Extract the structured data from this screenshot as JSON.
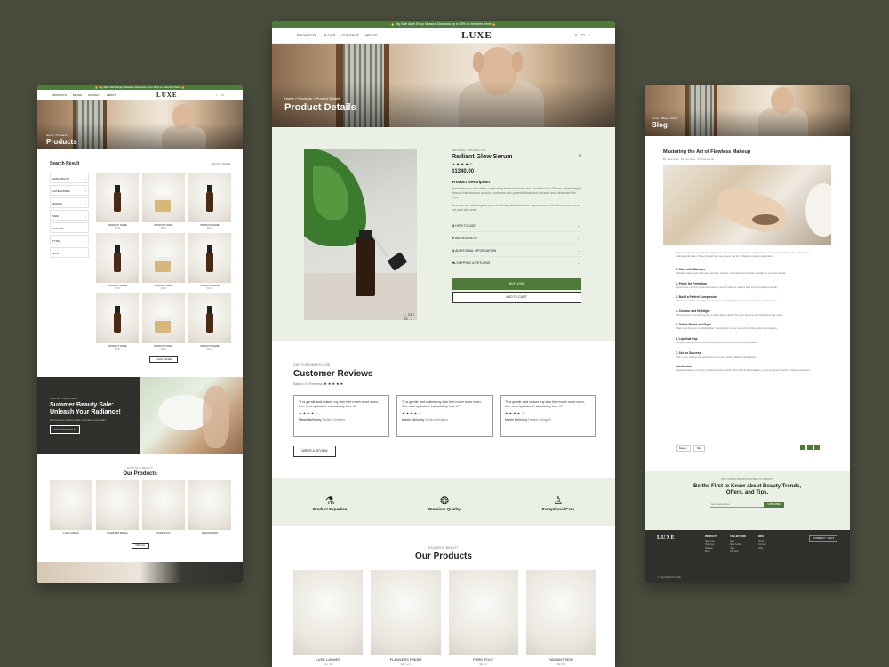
{
  "center": {
    "promo": "🔥 Big Sale Alert! Enjoy Massive Discounts up to 50% on Selected Items 🔥",
    "nav": [
      "PRODUCTS",
      "BLOGS",
      "CONTACT",
      "ABOUT"
    ],
    "logo": "LUXE",
    "breadcrumb": "Home > Products > Product Details",
    "hero_title": "Product Details",
    "pager": "01 / 03",
    "category": "ORGANIC PRODUCTS",
    "product_name": "Radiant Glow Serum",
    "price": "$1340.00",
    "desc_heading": "Product Description",
    "desc_p1": "Illuminate your skin with a captivating luminosity that lasts. Radiant Glow Serum, a lightweight formula that absorbs quickly, nourishes with powerful botanical extracts and minimizes fine lines.",
    "desc_p2": "Embrace the radiant glow as it effortlessly diminishes the appearance of fine lines and evens out your skin tone.",
    "accordion": [
      "HOW TO USE",
      "INGREDIENTS",
      "ADDITIONAL INFORMATION",
      "SHIPPING & RETURNS"
    ],
    "buy_now": "BUY NOW",
    "add_to_cart": "ADD TO CART",
    "reviews_eyebrow": "OUR CUSTOMERS LOVE",
    "reviews_title": "Customer Reviews",
    "based_on": "Based on Reviews",
    "review_text": "\"It is gentle and makes my skin feel much more even, firm, and hydrated. I absolutely love it!\"",
    "review_author": "Marvin McKinney",
    "review_role": "Fashion Designer",
    "write_review": "WRITE A REVIEW",
    "features": [
      "Product Expertise",
      "Premium Quality",
      "Exceptional Care"
    ],
    "products_eyebrow": "EXQUISITE BEAUTY",
    "products_title": "Our Products",
    "products": [
      {
        "name": "LUXE LASHES",
        "price": "$17.54"
      },
      {
        "name": "FLAWLESS FINISH",
        "price": "$41.22"
      },
      {
        "name": "PURE POUT",
        "price": "$8.70"
      },
      {
        "name": "RADIANT SKIN",
        "price": "$9.90"
      }
    ]
  },
  "left": {
    "promo": "🔥 Big Sale Alert! Enjoy Massive Discounts up to 50% on Selected Items 🔥",
    "nav": [
      "PRODUCTS",
      "BLOGS",
      "CONTACT",
      "ABOUT"
    ],
    "logo": "LUXE",
    "hero_crumb": "Home > Products",
    "hero_title": "Products",
    "search_result": "Search Result",
    "sort": "Sort by: Default",
    "filters": [
      "AVAILABILITY",
      "CATEGORIES",
      "RANGE",
      "SIZE",
      "COLORS",
      "TYPE",
      "SKIN"
    ],
    "grid_label": "PRODUCT NAME",
    "grid_price": "$0.00",
    "load_more": "LOAD MORE",
    "sale_eyebrow": "LIMITED TIME OFFER",
    "sale_title": "Summer Beauty Sale: Unleash Your Radiance!",
    "sale_sub": "Discover the hottest deals on beauty essentials",
    "shop_sale": "SHOP THE SALE",
    "products_eyebrow": "EXQUISITE BEAUTY",
    "products_title": "Our Products",
    "view_all": "VIEW ALL",
    "products": [
      "LUXE LASHES",
      "FLAWLESS FINISH",
      "PURE POUT",
      "RADIANT SKIN"
    ]
  },
  "right": {
    "crumb": "Home > Blog > Article",
    "hero_title": "Blog",
    "article_title": "Mastering the Art of Flawless Makeup",
    "meta": "By Jane Doe · 10 min read · 24 Comments",
    "intro": "Flawless makeup is an art that empowers us to enhance our features and express ourselves. Whether you're a novice or a makeup enthusiast, these tips will help you master the art of flawless makeup application.",
    "steps": [
      {
        "h": "1. Start with Skincare",
        "p": "A flawless base begins with good skincare. Cleanse, moisturize, and exfoliate regularly for a smooth canvas."
      },
      {
        "h": "2. Prime for Perfection",
        "p": "Primer helps minimize pores and creates a smooth base so makeup lasts longer throughout the day."
      },
      {
        "h": "3. Build a Perfect Complexion",
        "p": "Select a foundation matching your skin tone and apply with a sponge or brush for a seamless finish."
      },
      {
        "h": "4. Contour and Highlight",
        "p": "Add dimension by contouring with a shade slightly darker than your skin tone and highlighting high points."
      },
      {
        "h": "5. Define Brows and Eyes",
        "p": "Shape your brows for a polished look. Create depth on your eyes with neutral shades and mascara."
      },
      {
        "h": "6. Lips that Pop",
        "p": "Complete your look with a lip liner and a lipstick that complements your features."
      },
      {
        "h": "7. Set for Success",
        "p": "Lock in your makeup with setting spray for a long-lasting, flawless result all day."
      },
      {
        "h": "Conclusion",
        "p": "Flawless makeup is a journey of practice and creativity. With these fundamental tips, you're equipped to achieve makeup perfection."
      }
    ],
    "tags": [
      "Beauty",
      "Skin"
    ],
    "newsletter_eyebrow": "STAY CONNECTED WITH OUR BEAUTY INSIGHTS",
    "newsletter_title": "Be the First to Know about Beauty Trends, Offers, and Tips.",
    "email_placeholder": "Your email address",
    "subscribe": "SUBSCRIBE",
    "footer_logo": "LUXE",
    "footer_cols": [
      {
        "h": "PRODUCTS",
        "items": [
          "Skin Care",
          "Hair Care",
          "Makeup",
          "Body"
        ]
      },
      {
        "h": "COLLECTIONS",
        "items": [
          "New",
          "Best Sellers",
          "Sale",
          "Gift Sets"
        ]
      },
      {
        "h": "INFO",
        "items": [
          "About",
          "Contact",
          "FAQ"
        ]
      }
    ],
    "currency": "CURRENCY : USD $",
    "copyright": "© Copyright 2024 LUXE"
  }
}
